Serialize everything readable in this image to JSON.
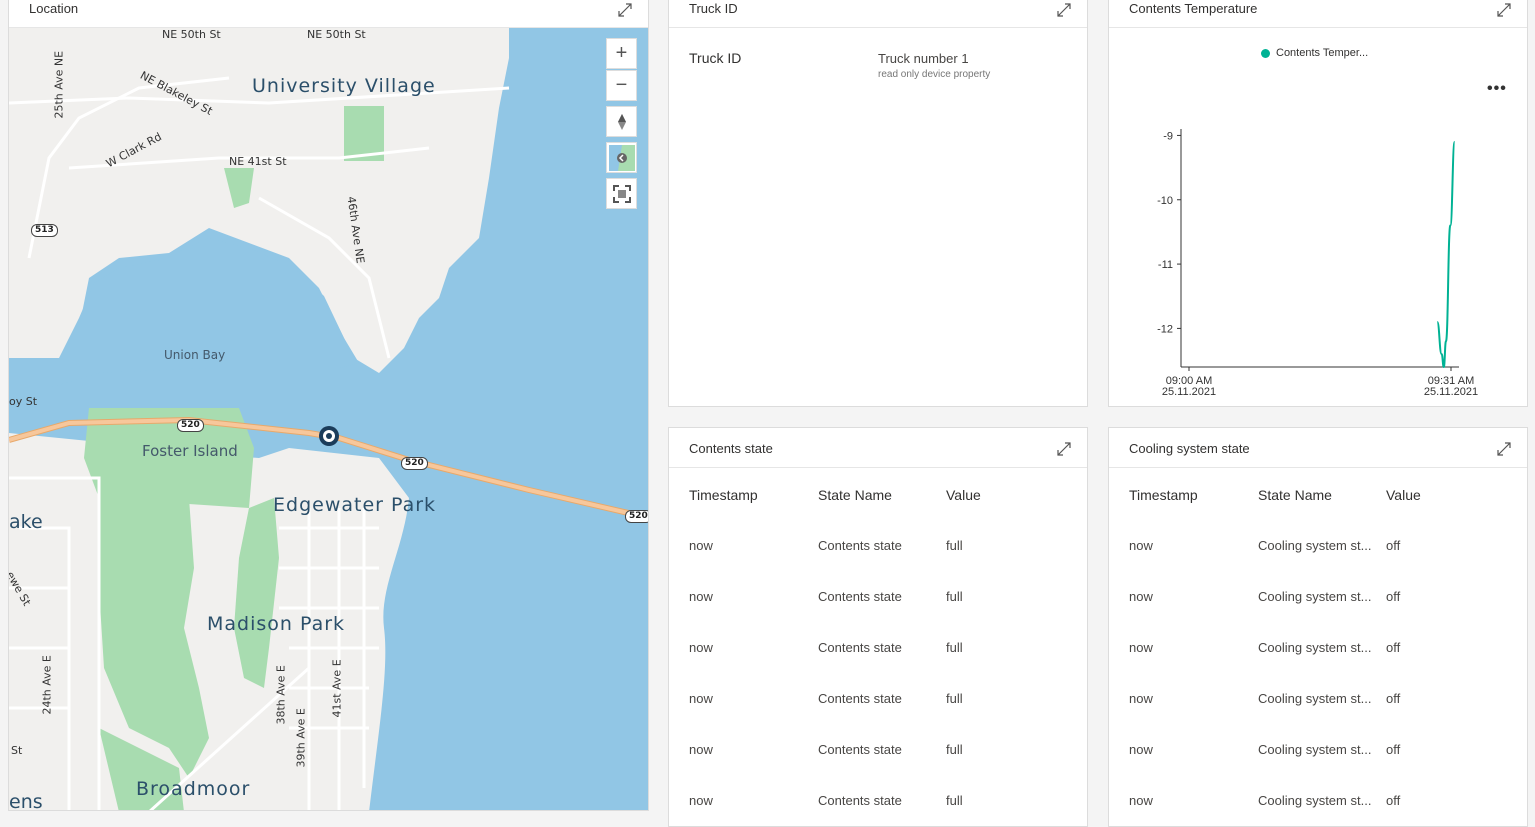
{
  "tiles": {
    "location": {
      "title": "Location"
    },
    "truck": {
      "title": "Truck ID",
      "property_label": "Truck ID",
      "property_value": "Truck number 1",
      "property_note": "read only device property"
    },
    "temperature": {
      "title": "Contents Temperature",
      "legend": "Contents Temper...",
      "more": "•••"
    },
    "contents": {
      "title": "Contents state",
      "columns": [
        "Timestamp",
        "State Name",
        "Value"
      ],
      "rows": [
        [
          "now",
          "Contents state",
          "full"
        ],
        [
          "now",
          "Contents state",
          "full"
        ],
        [
          "now",
          "Contents state",
          "full"
        ],
        [
          "now",
          "Contents state",
          "full"
        ],
        [
          "now",
          "Contents state",
          "full"
        ],
        [
          "now",
          "Contents state",
          "full"
        ]
      ]
    },
    "cooling": {
      "title": "Cooling system state",
      "columns": [
        "Timestamp",
        "State Name",
        "Value"
      ],
      "rows": [
        [
          "now",
          "Cooling system st...",
          "off"
        ],
        [
          "now",
          "Cooling system st...",
          "off"
        ],
        [
          "now",
          "Cooling system st...",
          "off"
        ],
        [
          "now",
          "Cooling system st...",
          "off"
        ],
        [
          "now",
          "Cooling system st...",
          "off"
        ],
        [
          "now",
          "Cooling system st...",
          "off"
        ]
      ]
    }
  },
  "map": {
    "controls": {
      "zoom_in": "+",
      "zoom_out": "−"
    },
    "places": {
      "university_village": "University Village",
      "union_bay": "Union Bay",
      "foster_island": "Foster Island",
      "edgewater_park": "Edgewater Park",
      "madison_park": "Madison Park",
      "broadmoor": "Broadmoor",
      "lake_partial": "ake",
      "ens_partial": "ens"
    },
    "streets": {
      "ne50th_a": "NE 50th St",
      "ne50th_b": "NE 50th St",
      "blakeley": "NE Blakeley St",
      "ave25": "25th Ave NE",
      "clark": "W Clark Rd",
      "ne41st": "NE 41st St",
      "ave46": "46th Ave NE",
      "by_st": "oy St",
      "ewe_st": "ewe St",
      "ave24": "24th Ave E",
      "ave38": "38th Ave E",
      "ave39": "39th Ave E",
      "ave41": "41st Ave E",
      "st_left": "St"
    },
    "shields": {
      "r513": "513",
      "r520a": "520",
      "r520b": "520",
      "r520c": "520"
    }
  },
  "colors": {
    "water": "#91c6e5",
    "land": "#f1f0ee",
    "park": "#a8dcb0",
    "series": "#00b294",
    "highway": "#f7c79b"
  },
  "chart_data": {
    "type": "line",
    "title": "Contents Temperature",
    "xlabel": "",
    "ylabel": "",
    "x_ticks": [
      {
        "time": "09:00 AM",
        "date": "25.11.2021"
      },
      {
        "time": "09:31 AM",
        "date": "25.11.2021"
      }
    ],
    "y_ticks": [
      -9,
      -10,
      -11,
      -12
    ],
    "ylim": [
      -12.6,
      -8.9
    ],
    "xlim": [
      "09:00",
      "09:32"
    ],
    "series": [
      {
        "name": "Contents Temper...",
        "x": [
          "09:29:30",
          "09:30:00",
          "09:30:15",
          "09:30:30",
          "09:31:00",
          "09:31:30"
        ],
        "values": [
          -11.9,
          -12.4,
          -12.6,
          -12.2,
          -10.4,
          -9.1
        ]
      }
    ]
  }
}
